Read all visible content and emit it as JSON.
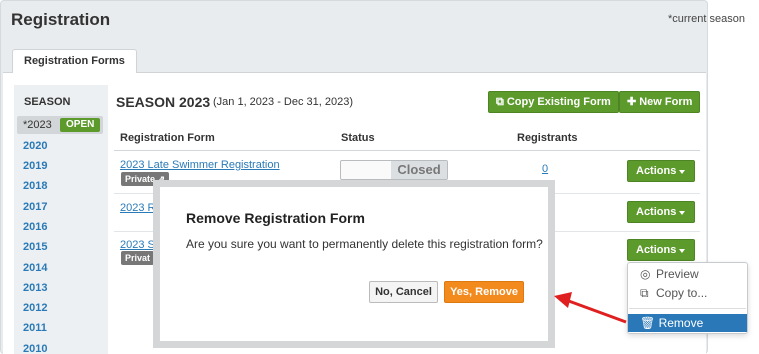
{
  "header": {
    "title": "Registration",
    "current_note": "*current season"
  },
  "tab": {
    "label": "Registration Forms"
  },
  "seasons": {
    "heading": "SEASON",
    "current": {
      "label": "*2023",
      "badge": "OPEN"
    },
    "years": [
      "2020",
      "2019",
      "2018",
      "2017",
      "2016",
      "2015",
      "2014",
      "2013",
      "2012",
      "2011",
      "2010"
    ]
  },
  "main": {
    "title": "SEASON 2023",
    "range": "(Jan 1, 2023 - Dec 31, 2023)",
    "copy_button": "Copy Existing Form",
    "new_button": "New Form"
  },
  "table": {
    "columns": [
      "Registration Form",
      "Status",
      "Registrants"
    ],
    "rows": [
      {
        "name": "2023 Late Swimmer Registration",
        "badge": "Private",
        "status": "Closed",
        "registrants": "0",
        "action": "Actions"
      },
      {
        "name": "2023 R",
        "badge": "",
        "status": "",
        "registrants": "",
        "action": "Actions"
      },
      {
        "name": "2023 S",
        "badge": "Privat",
        "status": "",
        "registrants": "",
        "action": "Actions"
      }
    ]
  },
  "dropdown": {
    "preview": "Preview",
    "copy_to": "Copy to...",
    "remove": "Remove"
  },
  "modal": {
    "title": "Remove Registration Form",
    "message": "Are you sure you want to permanently delete this registration form?",
    "cancel": "No, Cancel",
    "confirm": "Yes, Remove"
  },
  "colors": {
    "green": "#5c9a2c",
    "orange": "#f28a1e",
    "link": "#2a7ab8",
    "highlight": "#2a78b8",
    "arrow": "#e02020"
  }
}
